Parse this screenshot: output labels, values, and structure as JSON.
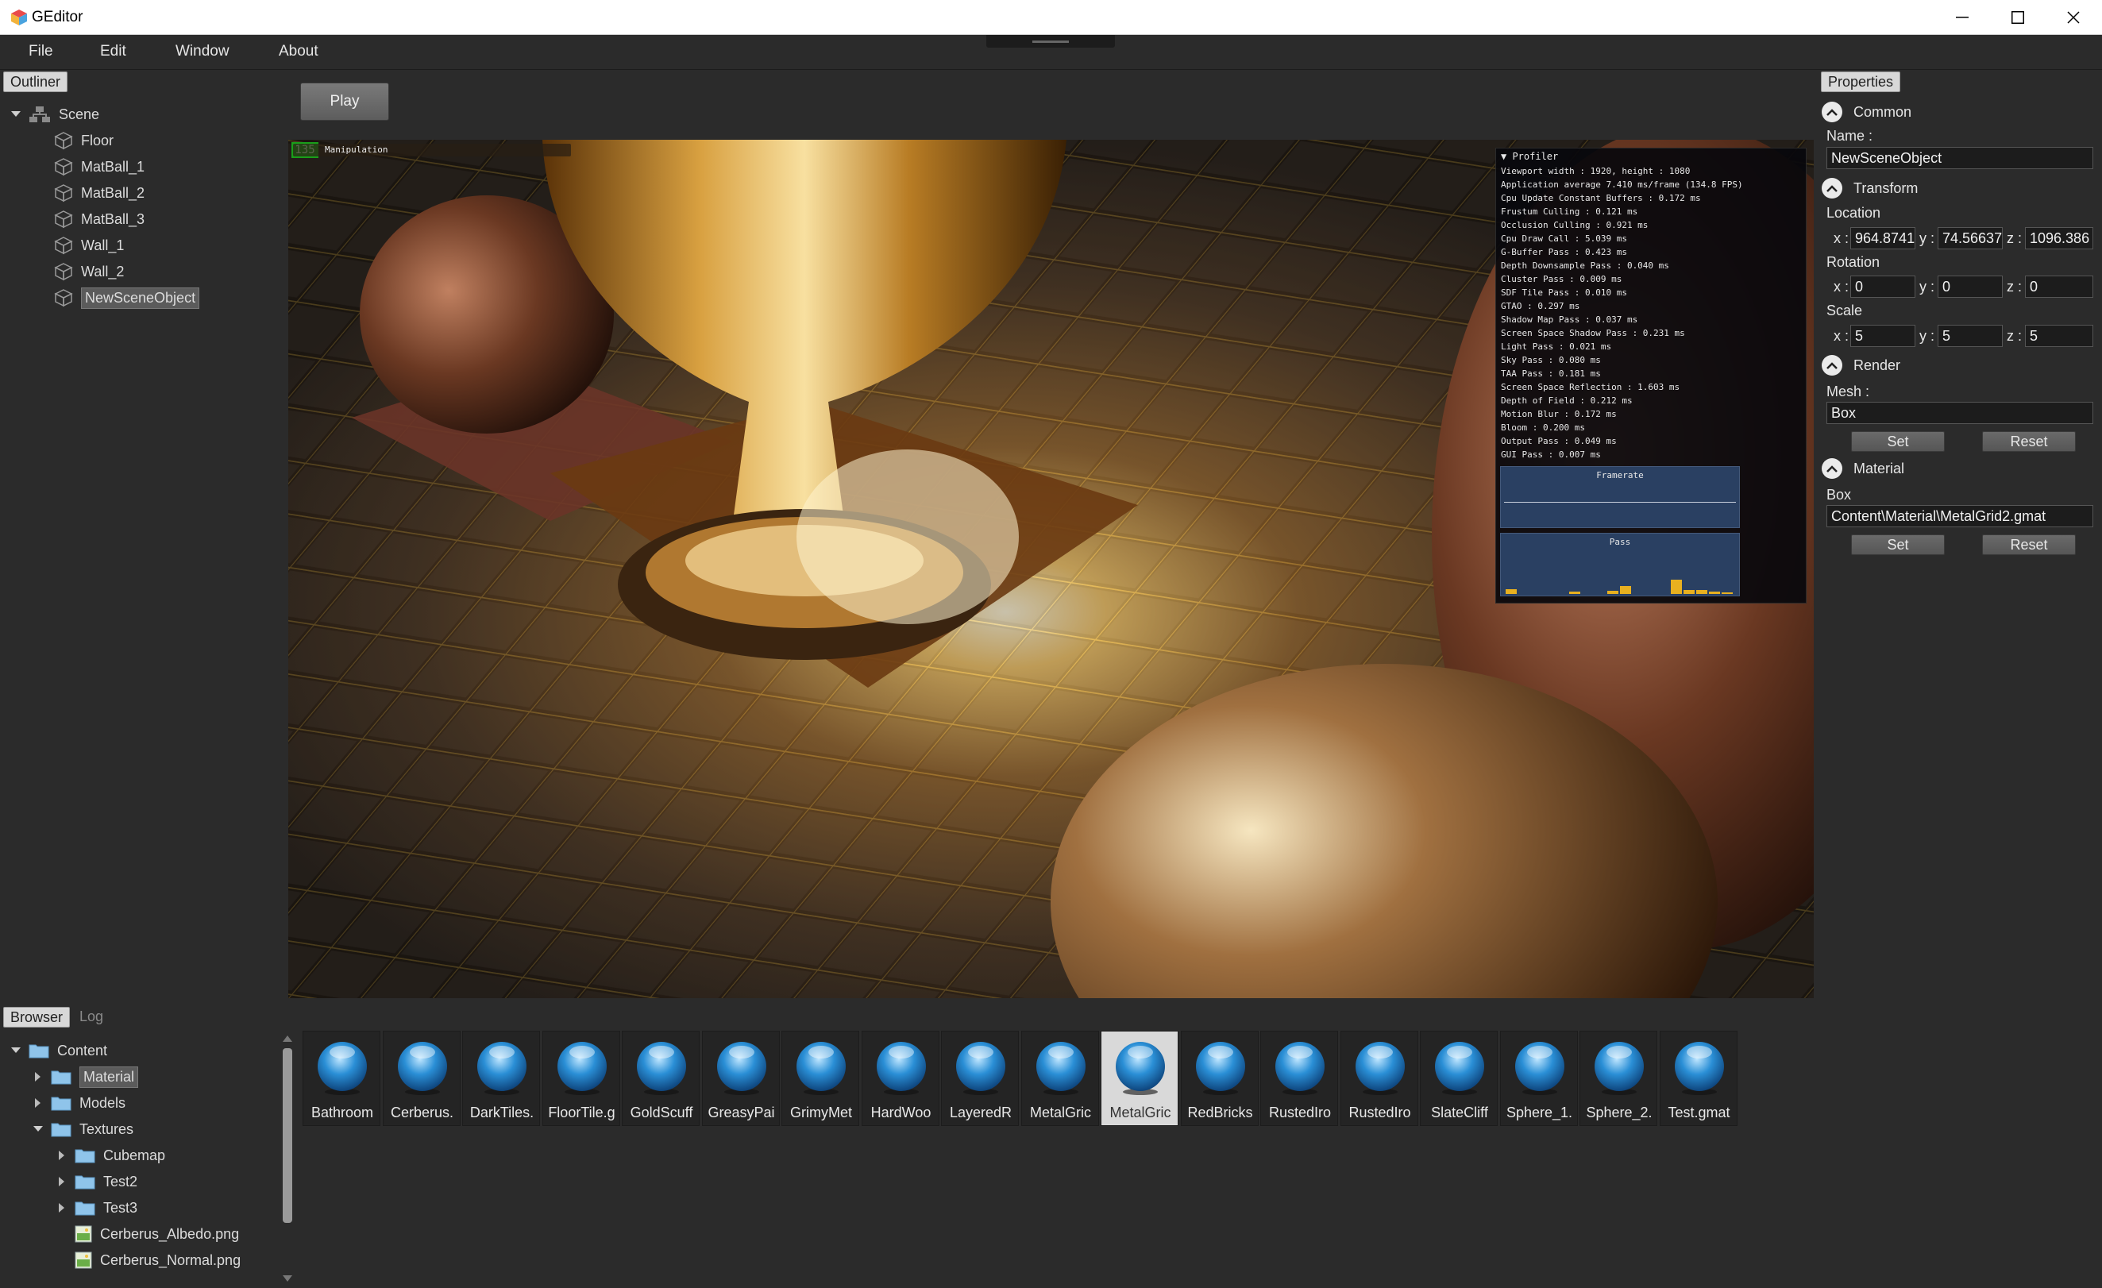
{
  "window": {
    "title": "GEditor"
  },
  "menu": {
    "file": "File",
    "edit": "Edit",
    "window": "Window",
    "about": "About"
  },
  "outliner": {
    "tab": "Outliner",
    "root": "Scene",
    "items": [
      "Floor",
      "MatBall_1",
      "MatBall_2",
      "MatBall_3",
      "Wall_1",
      "Wall_2",
      "NewSceneObject"
    ],
    "selected": "NewSceneObject"
  },
  "toolbar": {
    "play": "Play"
  },
  "viewport": {
    "fps_badge": "135",
    "manipulation_label": "Manipulation",
    "profiler": {
      "title": "Profiler",
      "lines": [
        "Viewport width : 1920, height : 1080",
        "Application average 7.410 ms/frame (134.8 FPS)",
        "Cpu Update Constant Buffers : 0.172 ms",
        "Frustum Culling : 0.121 ms",
        "Occlusion Culling : 0.921 ms",
        "Cpu Draw Call : 5.039 ms",
        "G-Buffer Pass : 0.423 ms",
        "Depth Downsample Pass : 0.040 ms",
        "Cluster Pass : 0.009 ms",
        "SDF Tile Pass : 0.010 ms",
        "GTAO : 0.297 ms",
        "Shadow Map Pass : 0.037 ms",
        "Screen Space Shadow Pass : 0.231 ms",
        "Light Pass : 0.021 ms",
        "Sky Pass : 0.080 ms",
        "TAA Pass : 0.181 ms",
        "Screen Space Reflection : 1.603 ms",
        "Depth of Field : 0.212 ms",
        "Motion Blur : 0.172 ms",
        "Bloom : 0.200 ms",
        "Output Pass : 0.049 ms",
        "GUI Pass : 0.007 ms"
      ],
      "framerate_label": "Framerate",
      "pass_label": "Pass",
      "pass_bars": [
        0.15,
        0,
        0,
        0,
        0,
        0.08,
        0,
        0,
        0.1,
        0.25,
        0,
        0,
        0,
        0.45,
        0.12,
        0.12,
        0.08,
        0.05
      ]
    }
  },
  "properties": {
    "tab": "Properties",
    "common": "Common",
    "name_label": "Name :",
    "name_value": "NewSceneObject",
    "transform": "Transform",
    "location": "Location",
    "location_x": "964.8741",
    "location_y": "74.56637",
    "location_z": "1096.386",
    "rotation": "Rotation",
    "rotation_x": "0",
    "rotation_y": "0",
    "rotation_z": "0",
    "scale": "Scale",
    "scale_x": "5",
    "scale_y": "5",
    "scale_z": "5",
    "axis_x": "x :",
    "axis_y": "y :",
    "axis_z": "z :",
    "render": "Render",
    "mesh_label": "Mesh :",
    "mesh_value": "Box",
    "set": "Set",
    "reset": "Reset",
    "material": "Material",
    "material_slot": "Box",
    "material_value": "Content\\Material\\MetalGrid2.gmat"
  },
  "browser": {
    "tab_browser": "Browser",
    "tab_log": "Log",
    "tree": {
      "content": "Content",
      "material": "Material",
      "models": "Models",
      "textures": "Textures",
      "cubemap": "Cubemap",
      "test2": "Test2",
      "test3": "Test3",
      "file1": "Cerberus_Albedo.png",
      "file2": "Cerberus_Normal.png"
    },
    "assets": [
      "Bathroom",
      "Cerberus.",
      "DarkTiles.",
      "FloorTile.g",
      "GoldScuff",
      "GreasyPai",
      "GrimyMet",
      "HardWoo",
      "LayeredR",
      "MetalGric",
      "MetalGric",
      "RedBricks",
      "RustedIro",
      "RustedIro",
      "SlateCliff",
      "Sphere_1.",
      "Sphere_2.",
      "Test.gmat"
    ],
    "selected_index": 10
  },
  "colors": {
    "accent": "#2b2b2b",
    "ball": "#2a8fd6"
  }
}
